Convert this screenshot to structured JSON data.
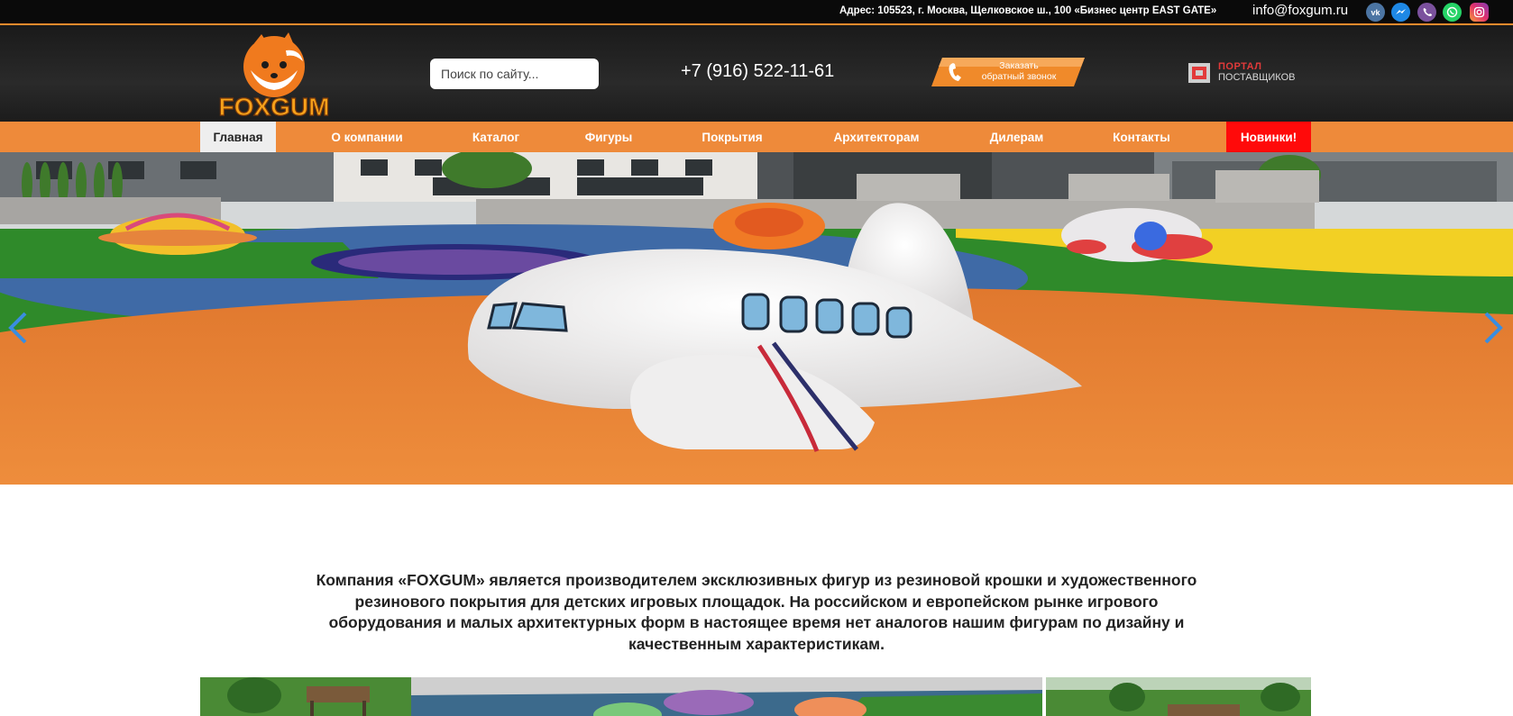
{
  "topbar": {
    "address": "Адрес: 105523, г. Москва, Щелковское ш., 100 «Бизнес центр EAST GATE»",
    "email": "info@foxgum.ru",
    "social": [
      {
        "icon": "vk-icon",
        "glyph": "vk",
        "color": "#4c75a3"
      },
      {
        "icon": "messenger-icon",
        "glyph": "m",
        "color": "#1e88e5"
      },
      {
        "icon": "viber-icon",
        "glyph": "v",
        "color": "#7b519d"
      },
      {
        "icon": "whatsapp-icon",
        "glyph": "w",
        "color": "#25d366"
      },
      {
        "icon": "instagram-icon",
        "glyph": "ig",
        "color": "#d6249f"
      }
    ]
  },
  "header": {
    "logo_text": "FOXGUM",
    "search_placeholder": "Поиск по сайту...",
    "phone": "+7 (916) 522-11-61",
    "callback_line1": "Заказать",
    "callback_line2": "обратный звонок",
    "portal_line1": "ПОРТАЛ",
    "portal_line2": "ПОСТАВЩИКОВ"
  },
  "nav": {
    "items": [
      {
        "label": "Главная",
        "active": true
      },
      {
        "label": "О компании"
      },
      {
        "label": "Каталог"
      },
      {
        "label": "Фигуры"
      },
      {
        "label": "Покрытия"
      },
      {
        "label": "Архитекторам"
      },
      {
        "label": "Дилерам"
      },
      {
        "label": "Контакты"
      },
      {
        "label": "Новинки!",
        "highlight": true
      }
    ]
  },
  "intro": {
    "text": "Компания «FOXGUM» является производителем эксклюзивных фигур из резиновой крошки и художественного резинового покрытия для детских игровых площадок. На российском и европейском рынке игрового оборудования и малых архитектурных форм в настоящее время нет аналогов нашим фигурам по дизайну и качественным характеристикам."
  },
  "colors": {
    "accent": "#ee8a3a",
    "highlight": "#ff0a0a",
    "header_bg": "#1f1f1f"
  }
}
